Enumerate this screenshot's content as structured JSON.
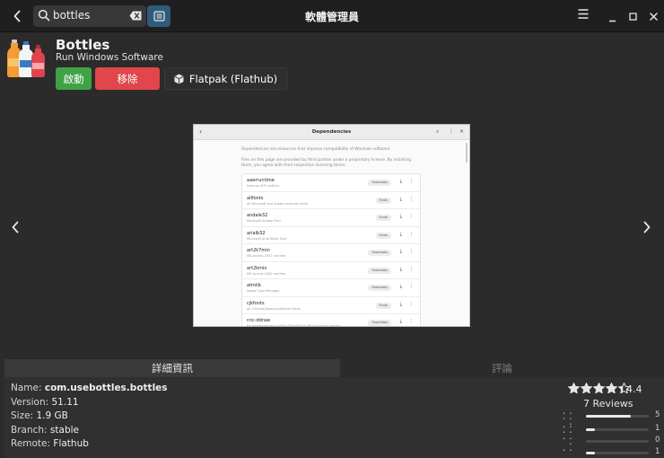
{
  "window": {
    "title": "軟體管理員"
  },
  "search": {
    "query": "bottles"
  },
  "app": {
    "name": "Bottles",
    "summary": "Run Windows Software",
    "launch_label": "啟動",
    "remove_label": "移除",
    "source_label": "Flatpak (Flathub)"
  },
  "screenshot": {
    "title": "Dependencies",
    "intro": "Dependencies are resources that improve compatibility of Windows software.",
    "intro2": "Files on this page are provided by third parties under a proprietary license. By installing them, you agree with their respective licensing terms.",
    "items": [
      {
        "name": "aaerruntime",
        "desc": "Harman AIR runtime",
        "badge": "Essentials"
      },
      {
        "name": "allfonts",
        "desc": "All Microsoft and Adobe essential fonts",
        "badge": "Fonts"
      },
      {
        "name": "andale32",
        "desc": "Microsoft Andale Font",
        "badge": "Fonts"
      },
      {
        "name": "arialb32",
        "desc": "Microsoft Arial Black Font",
        "badge": "Fonts"
      },
      {
        "name": "art2k7min",
        "desc": "MS Access 2007 runtime",
        "badge": "Essentials"
      },
      {
        "name": "art2kmin",
        "desc": "MS Access 2000 runtime",
        "badge": "Essentials"
      },
      {
        "name": "atmlib",
        "desc": "Adobe Type Manager",
        "badge": "Essentials"
      },
      {
        "name": "cjkfonts",
        "desc": "All Chinese/Japanese/Korean fonts",
        "badge": "Fonts"
      },
      {
        "name": "cnc-ddraw",
        "desc": "Re-implementation of the DirectDraw API for classic games",
        "badge": "Essentials"
      }
    ]
  },
  "tabs": {
    "details": "詳細資訊",
    "reviews": "評論"
  },
  "details": {
    "name_label": "Name:",
    "name_value": "com.usebottles.bottles",
    "version_label": "Version:",
    "version_value": "51.11",
    "size_label": "Size:",
    "size_value": "1.9 GB",
    "branch_label": "Branch:",
    "branch_value": "stable",
    "remote_label": "Remote:",
    "remote_value": "Flathub"
  },
  "rating": {
    "value": "4.4",
    "score": 4.4,
    "reviews": "7 Reviews",
    "histogram": [
      {
        "stars": "• • • • •",
        "count": "5",
        "fraction": 0.71
      },
      {
        "stars": "• • • •",
        "count": "1",
        "fraction": 0.14
      },
      {
        "stars": "• • •",
        "count": "0",
        "fraction": 0.0
      },
      {
        "stars": "• •",
        "count": "1",
        "fraction": 0.14
      }
    ]
  },
  "colors": {
    "launch": "#3fa244",
    "remove": "#e0464b",
    "accent": "#2f5b7a"
  }
}
